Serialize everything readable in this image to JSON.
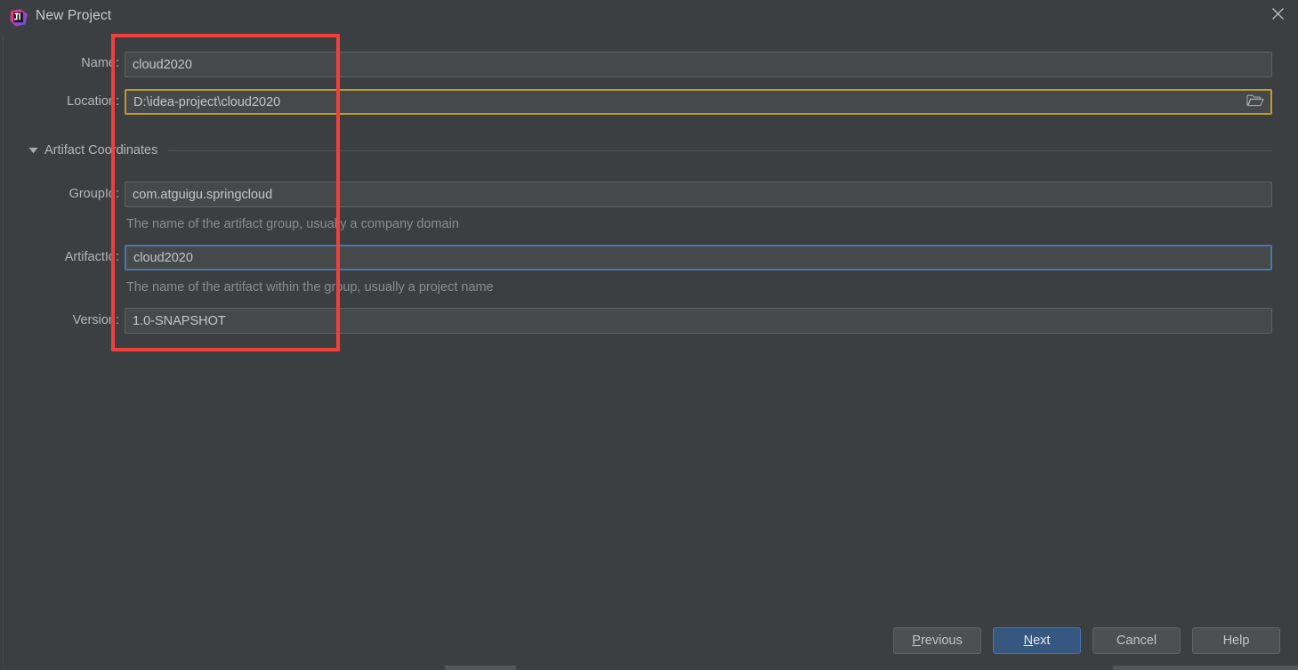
{
  "window": {
    "title": "New Project",
    "app_icon": "intellij-idea-icon",
    "close_icon": "close-icon"
  },
  "form": {
    "name": {
      "label": "Name:",
      "value": "cloud2020",
      "placeholder": "",
      "state": "normal"
    },
    "location": {
      "label": "Location:",
      "value": "D:\\idea-project\\cloud2020",
      "placeholder": "",
      "state": "warning",
      "browse_icon": "folder-icon"
    }
  },
  "artifact_section": {
    "label": "Artifact Coordinates",
    "expanded": true,
    "arrow_icon": "triangle-down-icon",
    "group_id": {
      "label": "GroupId:",
      "value": "com.atguigu.springcloud",
      "hint": "The name of the artifact group, usually a company domain",
      "state": "normal"
    },
    "artifact_id": {
      "label": "ArtifactId:",
      "value": "cloud2020",
      "hint": "The name of the artifact within the group, usually a project name",
      "state": "focused"
    },
    "version": {
      "label": "Version:",
      "value": "1.0-SNAPSHOT",
      "hint": "",
      "state": "normal"
    }
  },
  "footer": {
    "previous": {
      "prefix": "",
      "mnemonic": "P",
      "suffix": "revious"
    },
    "next": {
      "prefix": "",
      "mnemonic": "N",
      "suffix": "ext"
    },
    "cancel": {
      "label": "Cancel"
    },
    "help": {
      "label": "Help"
    }
  },
  "colors": {
    "background": "#3c3f41",
    "field_background": "#45494a",
    "field_border": "#5e6060",
    "warning_border": "#bd9b2c",
    "focus_border": "#4b77a8",
    "primary_button": "#365880",
    "annotation": "#f1403c",
    "text": "#bbbbbb",
    "hint_text": "#8a8d8f"
  },
  "annotation": {
    "shape": "rectangle",
    "color": "#f1403c"
  }
}
